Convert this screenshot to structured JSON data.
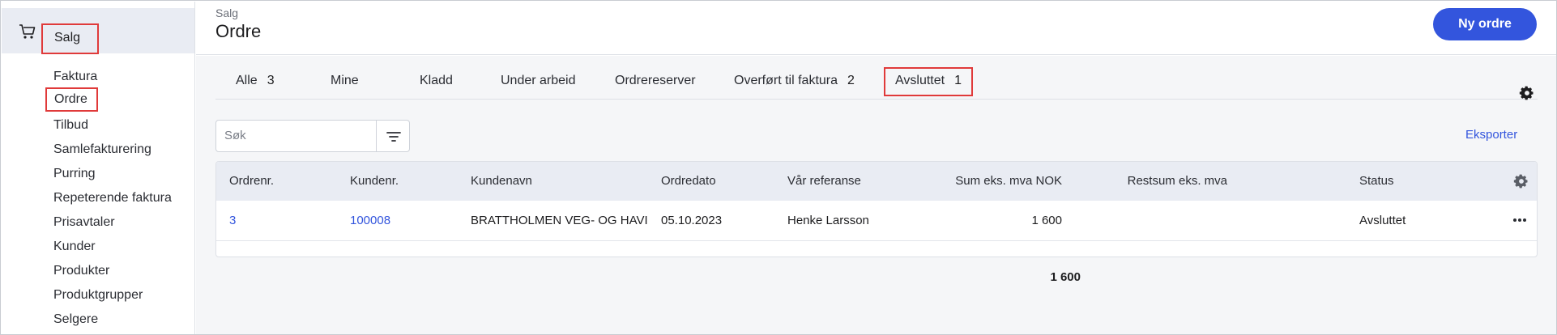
{
  "sidebar": {
    "module_label": "Salg",
    "items": [
      {
        "label": "Faktura"
      },
      {
        "label": "Ordre"
      },
      {
        "label": "Tilbud"
      },
      {
        "label": "Samlefakturering"
      },
      {
        "label": "Purring"
      },
      {
        "label": "Repeterende faktura"
      },
      {
        "label": "Prisavtaler"
      },
      {
        "label": "Kunder"
      },
      {
        "label": "Produkter"
      },
      {
        "label": "Produktgrupper"
      },
      {
        "label": "Selgere"
      }
    ],
    "active_index": 1
  },
  "header": {
    "breadcrumb": "Salg",
    "title": "Ordre",
    "new_button": "Ny ordre"
  },
  "tabs": [
    {
      "label": "Alle",
      "count": "3"
    },
    {
      "label": "Mine",
      "count": ""
    },
    {
      "label": "Kladd",
      "count": ""
    },
    {
      "label": "Under arbeid",
      "count": ""
    },
    {
      "label": "Ordrereserver",
      "count": ""
    },
    {
      "label": "Overført til faktura",
      "count": "2"
    },
    {
      "label": "Avsluttet",
      "count": "1"
    }
  ],
  "search": {
    "placeholder": "Søk"
  },
  "export_label": "Eksporter",
  "table": {
    "columns": [
      "Ordrenr.",
      "Kundenr.",
      "Kundenavn",
      "Ordredato",
      "Vår referanse",
      "Sum eks. mva NOK",
      "Restsum eks. mva",
      "Status"
    ],
    "rows": [
      {
        "ordrenr": "3",
        "kundenr": "100008",
        "kundenavn": "BRATTHOLMEN VEG- OG HAVI",
        "ordredato": "05.10.2023",
        "referanse": "Henke Larsson",
        "sum": "1 600",
        "restsum": "",
        "status": "Avsluttet"
      }
    ],
    "total_sum": "1 600"
  },
  "colors": {
    "accent": "#3355dd",
    "highlight": "#e03a3a",
    "module_bg": "#e9ecf3"
  },
  "icons": [
    "cart-icon",
    "settings-gear-icon",
    "filter-icon",
    "more-horizontal-icon"
  ]
}
